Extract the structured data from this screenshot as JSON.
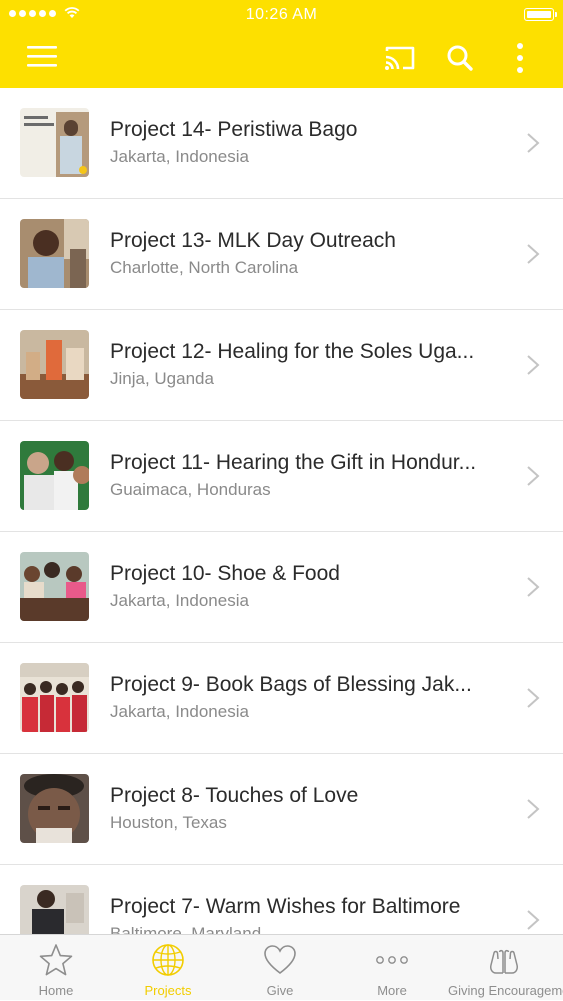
{
  "status_bar": {
    "time": "10:26 AM"
  },
  "header": {
    "menu_icon": "hamburger-menu-icon",
    "cast_icon": "cast-icon",
    "search_icon": "search-icon",
    "more_icon": "more-vertical-icon",
    "background": "#fde000"
  },
  "projects": [
    {
      "title": "Project 14- Peristiwa Bago",
      "location": "Jakarta, Indonesia"
    },
    {
      "title": "Project 13- MLK Day Outreach",
      "location": "Charlotte, North Carolina"
    },
    {
      "title": "Project 12- Healing for the Soles Uga...",
      "location": "Jinja, Uganda"
    },
    {
      "title": "Project 11- Hearing the Gift in Hondur...",
      "location": "Guaimaca, Honduras"
    },
    {
      "title": "Project 10- Shoe & Food",
      "location": "Jakarta, Indonesia"
    },
    {
      "title": "Project 9- Book Bags of Blessing Jak...",
      "location": "Jakarta, Indonesia"
    },
    {
      "title": "Project 8- Touches of Love",
      "location": "Houston, Texas"
    },
    {
      "title": "Project 7- Warm Wishes for Baltimore",
      "location": "Baltimore, Maryland"
    }
  ],
  "tabs": [
    {
      "label": "Home",
      "icon": "star-icon",
      "active": false
    },
    {
      "label": "Projects",
      "icon": "globe-icon",
      "active": true
    },
    {
      "label": "Give",
      "icon": "heart-icon",
      "active": false
    },
    {
      "label": "More",
      "icon": "more-dots-icon",
      "active": false
    },
    {
      "label": "Giving Encouragemen",
      "icon": "praying-hands-icon",
      "active": false
    }
  ],
  "colors": {
    "accent": "#fde000",
    "tab_active": "#f2cd00",
    "tab_inactive": "#8e8e8e"
  }
}
